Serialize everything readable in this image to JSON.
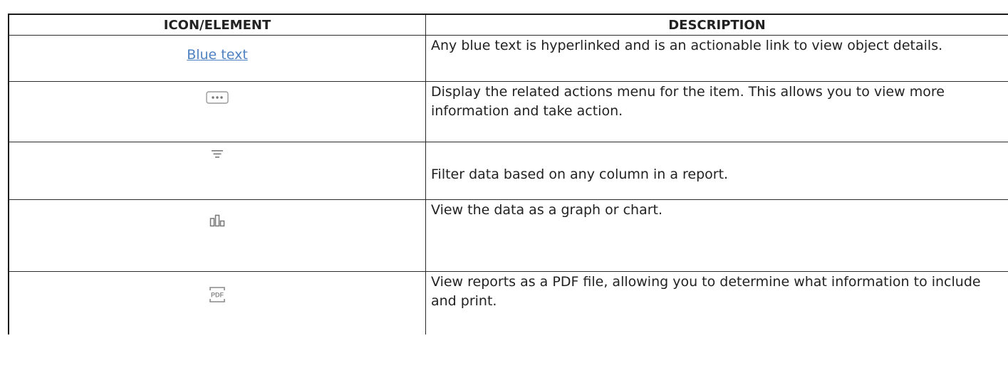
{
  "table": {
    "headers": [
      "ICON/ELEMENT",
      "DESCRIPTION"
    ],
    "rows": [
      {
        "element_text": "Blue text",
        "icon": "link-text",
        "description": "Any blue text is hyperlinked and is an actionable link to view object details."
      },
      {
        "icon": "more-options-icon",
        "description": "Display the related actions menu for the item. This allows you to view more information and take action."
      },
      {
        "icon": "filter-icon",
        "description": "Filter data based on any column in a report."
      },
      {
        "icon": "bar-chart-icon",
        "description": "View the data as a graph or chart."
      },
      {
        "icon": "pdf-icon",
        "icon_label": "PDF",
        "description": "View reports as a PDF file, allowing you to determine what information to include and print."
      }
    ]
  },
  "colors": {
    "link": "#4f82c2",
    "icon": "#8a8a8a",
    "border": "#1b1b1b"
  }
}
